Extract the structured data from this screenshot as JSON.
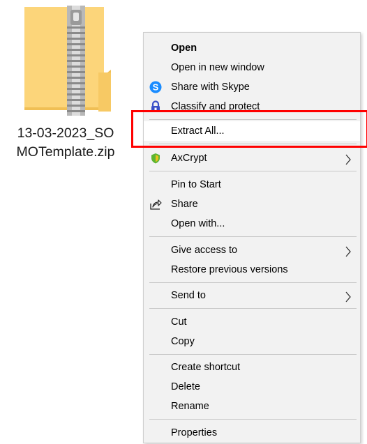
{
  "file": {
    "name_line1": "13-03-2023_SO",
    "name_line2": "MOTemplate.zip"
  },
  "colors": {
    "folder": "#fdd87a",
    "highlight": "#ff0000",
    "skype": "#1a8cff",
    "axcrypt": "#5cb531"
  },
  "menu": {
    "open": "Open",
    "open_new_window": "Open in new window",
    "share_skype": "Share with Skype",
    "classify_protect": "Classify and protect",
    "extract_all": "Extract All...",
    "axcrypt": "AxCrypt",
    "pin_to_start": "Pin to Start",
    "share": "Share",
    "open_with": "Open with...",
    "give_access": "Give access to",
    "restore_versions": "Restore previous versions",
    "send_to": "Send to",
    "cut": "Cut",
    "copy": "Copy",
    "create_shortcut": "Create shortcut",
    "delete": "Delete",
    "rename": "Rename",
    "properties": "Properties"
  },
  "icons": {
    "skype": "skype-icon",
    "classify": "classify-lock-icon",
    "axcrypt": "axcrypt-shield-icon",
    "share": "share-icon",
    "submenu": "chevron-right-icon"
  }
}
